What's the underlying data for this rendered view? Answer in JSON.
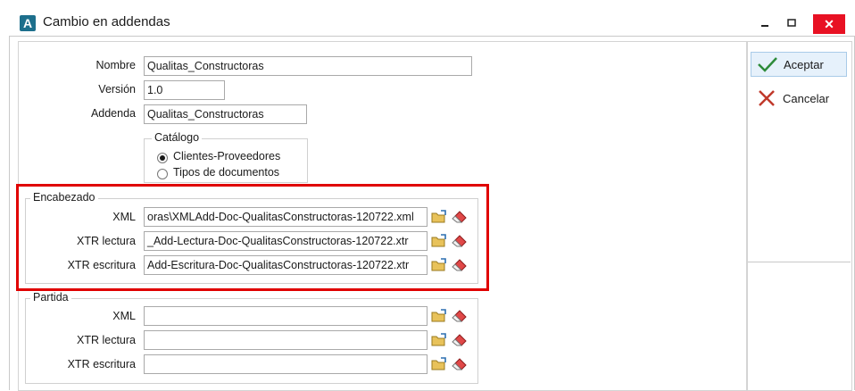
{
  "window": {
    "title": "Cambio en addendas",
    "app_icon_letter": "A",
    "minimize_glyph": "‗",
    "maximize_glyph": "▭",
    "close_glyph": "✕"
  },
  "form": {
    "nombre_label": "Nombre",
    "nombre_value": "Qualitas_Constructoras",
    "version_label": "Versión",
    "version_value": "1.0",
    "addenda_label": "Addenda",
    "addenda_value": "Qualitas_Constructoras"
  },
  "catalogo": {
    "legend": "Catálogo",
    "options": [
      {
        "label": "Clientes-Proveedores",
        "selected": true
      },
      {
        "label": "Tipos de documentos",
        "selected": false
      }
    ]
  },
  "encabezado": {
    "legend": "Encabezado",
    "xml_label": "XML",
    "xml_value": "oras\\XMLAdd-Doc-QualitasConstructoras-120722.xml",
    "xtr_lectura_label": "XTR lectura",
    "xtr_lectura_value": "_Add-Lectura-Doc-QualitasConstructoras-120722.xtr",
    "xtr_escritura_label": "XTR escritura",
    "xtr_escritura_value": "Add-Escritura-Doc-QualitasConstructoras-120722.xtr"
  },
  "partida": {
    "legend": "Partida",
    "xml_label": "XML",
    "xml_value": "",
    "xtr_lectura_label": "XTR lectura",
    "xtr_lectura_value": "",
    "xtr_escritura_label": "XTR escritura",
    "xtr_escritura_value": ""
  },
  "actions": {
    "accept_label": "Aceptar",
    "cancel_label": "Cancelar"
  },
  "icons": {
    "browse": "folder-browse-icon",
    "clear": "eraser-icon",
    "accept": "checkmark-icon",
    "cancel": "x-icon"
  },
  "colors": {
    "highlight": "#e00000",
    "close_button": "#e81123",
    "accept_check": "#2e8b3a",
    "cancel_x": "#c0392b"
  }
}
